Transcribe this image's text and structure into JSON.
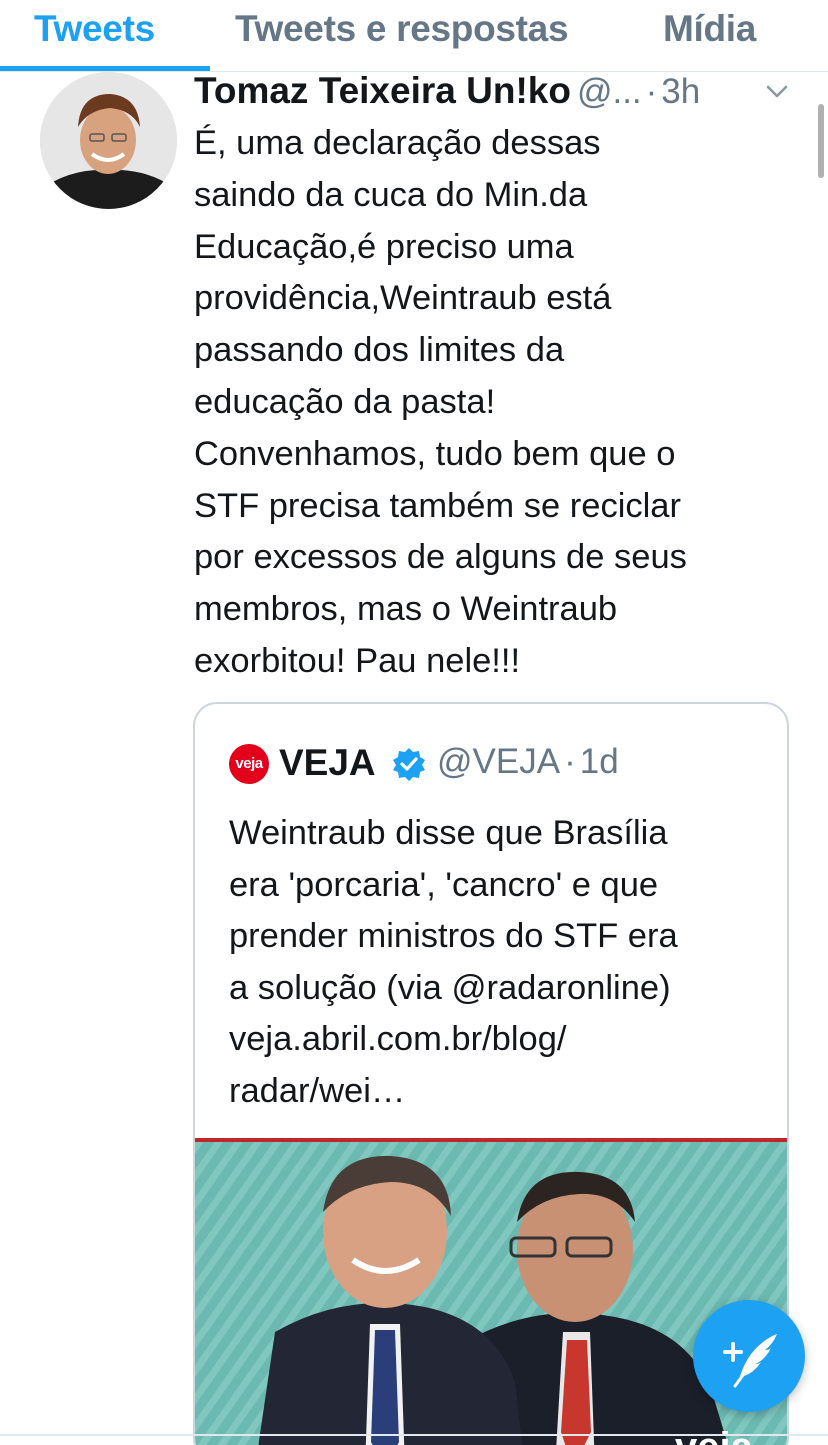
{
  "tabs": [
    {
      "label": "Tweets",
      "active": true
    },
    {
      "label": "Tweets e respostas",
      "active": false
    },
    {
      "label": "Mídia",
      "active": false
    }
  ],
  "tweet": {
    "author_name": "Tomaz Teixeira Un!ko",
    "handle": "@...",
    "separator": "·",
    "time": "3h",
    "text": "É, uma declaração dessas\nsaindo da cuca do Min.da\nEducação,é preciso uma\nprovidência,Weintraub está\npassando dos limites da\neducação da pasta!\nConvenhamos, tudo bem que o\nSTF precisa também se reciclar\npor excessos de alguns de seus\nmembros, mas o Weintraub\nexorbitou! Pau nele!!!"
  },
  "quoted_tweet": {
    "logo_text": "veja",
    "name": "VEJA",
    "handle": "@VEJA",
    "separator": "·",
    "time": "1d",
    "text": "Weintraub disse que Brasília\nera 'porcaria', 'cancro' e que\nprender ministros do STF era\na solução (via @radaronline)\nveja.abril.com.br/blog/\nradar/wei…",
    "image_watermark": "veja"
  },
  "colors": {
    "accent": "#1da1f2",
    "secondary_text": "#657786",
    "veja_red": "#e3001b"
  },
  "icons": {
    "menu": "chevron-down-icon",
    "verified": "verified-badge-icon",
    "compose": "compose-tweet-icon"
  }
}
